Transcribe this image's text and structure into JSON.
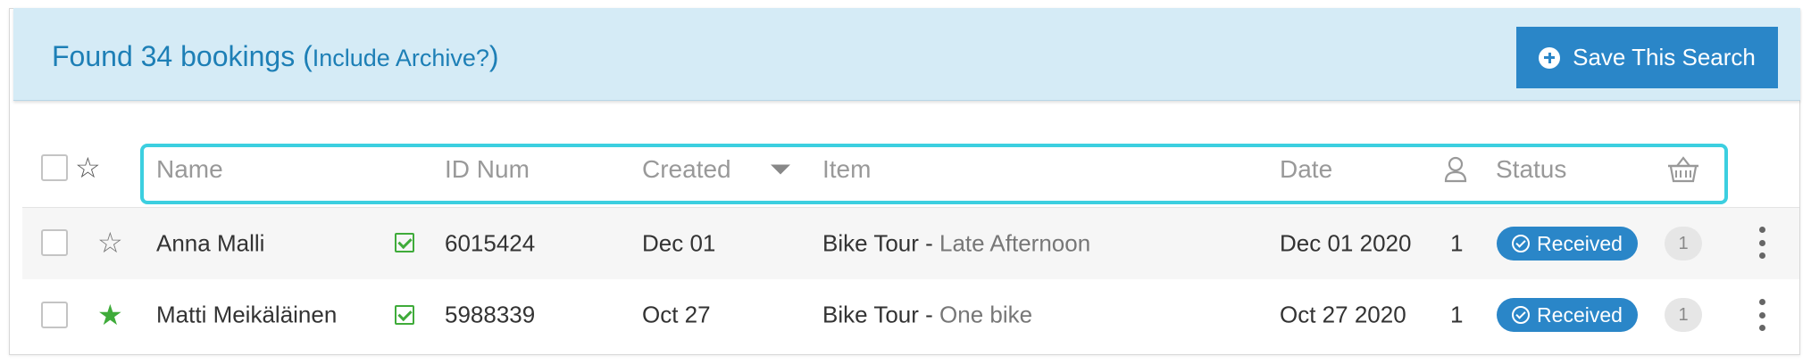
{
  "banner": {
    "title": "Found 34 bookings",
    "open_paren": "(",
    "archive_link": "Include Archive?",
    "close_paren": ")",
    "save_button": "Save This Search"
  },
  "table": {
    "columns": {
      "name": "Name",
      "id_num": "ID Num",
      "created": "Created",
      "item": "Item",
      "date": "Date",
      "status": "Status"
    },
    "rows": [
      {
        "name": "Anna Malli",
        "id_num": "6015424",
        "created": "Dec 01",
        "item_main": "Bike Tour - ",
        "item_detail": "Late Afternoon",
        "date": "Dec 01 2020",
        "people": "1",
        "status": "Received",
        "count": "1",
        "starred": false
      },
      {
        "name": "Matti Meikäläinen",
        "id_num": "5988339",
        "created": "Oct 27",
        "item_main": "Bike Tour - ",
        "item_detail": "One bike",
        "date": "Oct 27 2020",
        "people": "1",
        "status": "Received",
        "count": "1",
        "starred": true
      }
    ]
  },
  "colors": {
    "banner_bg": "#d5ebf6",
    "accent": "#2a86c8",
    "highlight": "#3ccfe0",
    "star_filled": "#3fab3a"
  }
}
